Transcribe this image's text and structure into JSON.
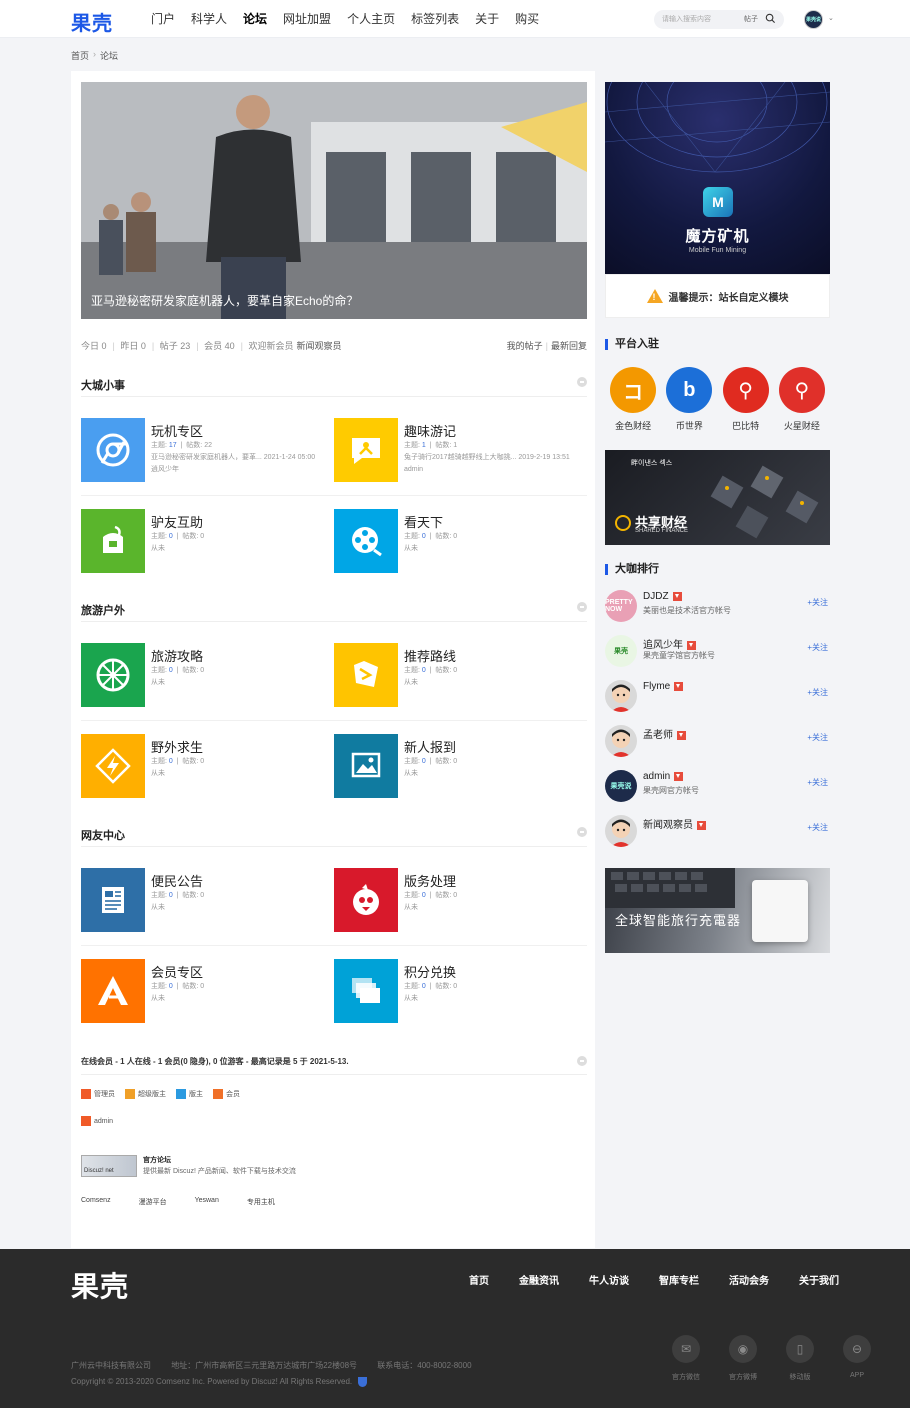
{
  "header": {
    "logo": "果壳",
    "nav": [
      "门户",
      "科学人",
      "论坛",
      "网址加盟",
      "个人主页",
      "标签列表",
      "关于",
      "购买"
    ],
    "active_nav": "论坛",
    "search_placeholder": "请输入搜索内容",
    "search_type": "帖子"
  },
  "breadcrumb": {
    "home": "首页",
    "sep": "›",
    "current": "论坛"
  },
  "banner": {
    "caption": "亚马逊秘密研发家庭机器人，要革自家Echo的命？"
  },
  "stats": {
    "today": "今日 0",
    "yesterday": "昨日 0",
    "posts": "帖子 23",
    "members": "会员 40",
    "welcome": "欢迎新会员 ",
    "new_member": "新闻观察员",
    "my_posts": "我的帖子",
    "latest_reply": "最新回复"
  },
  "sections": [
    {
      "title": "大城小事",
      "forums": [
        {
          "name": "玩机专区",
          "topics": "17",
          "posts": "22",
          "last": "亚马逊秘密研发家庭机器人，要革... 2021-1-24 05:00 逍风少年",
          "color": "#4a9ef0"
        },
        {
          "name": "趣味游记",
          "topics": "1",
          "posts": "1",
          "last": "兔子骑行2017越骑越野线上大咖挑... 2019-2-19 13:51 admin",
          "color": "#ffcb00"
        },
        {
          "name": "驴友互助",
          "topics": "0",
          "posts": "0",
          "last": "从未",
          "color": "#5ab52c"
        },
        {
          "name": "看天下",
          "topics": "0",
          "posts": "0",
          "last": "从未",
          "color": "#00a6e6"
        }
      ]
    },
    {
      "title": "旅游户外",
      "forums": [
        {
          "name": "旅游攻略",
          "topics": "0",
          "posts": "0",
          "last": "从未",
          "color": "#1aa54e"
        },
        {
          "name": "推荐路线",
          "topics": "0",
          "posts": "0",
          "last": "从未",
          "color": "#ffc400"
        },
        {
          "name": "野外求生",
          "topics": "0",
          "posts": "0",
          "last": "从未",
          "color": "#ffaf00"
        },
        {
          "name": "新人报到",
          "topics": "0",
          "posts": "0",
          "last": "从未",
          "color": "#107ba0"
        }
      ]
    },
    {
      "title": "网友中心",
      "forums": [
        {
          "name": "便民公告",
          "topics": "0",
          "posts": "0",
          "last": "从未",
          "color": "#2e6fa7"
        },
        {
          "name": "版务处理",
          "topics": "0",
          "posts": "0",
          "last": "从未",
          "color": "#d8192b"
        },
        {
          "name": "会员专区",
          "topics": "0",
          "posts": "0",
          "last": "从未",
          "color": "#ff7200"
        },
        {
          "name": "积分兑换",
          "topics": "0",
          "posts": "0",
          "last": "从未",
          "color": "#00a2d7"
        }
      ]
    }
  ],
  "forum_labels": {
    "topics": "主题: ",
    "posts": "帖数: "
  },
  "online": {
    "title": "在线会员 - 1 人在线 - 1 会员(0 隐身), 0 位游客 - 最高记录是 5 于 2021-5-13.",
    "legend": [
      {
        "label": "管理员",
        "color": "#f05a28"
      },
      {
        "label": "超级版主",
        "color": "#f0a028"
      },
      {
        "label": "版主",
        "color": "#2b9ae0"
      },
      {
        "label": "会员",
        "color": "#f07028"
      }
    ],
    "user": "admin"
  },
  "official": {
    "badge": "Discuz! net",
    "title": "官方论坛",
    "desc": "提供最新 Discuz! 产品新闻、软件下载与技术交流"
  },
  "links": [
    "Comsenz",
    "漫游平台",
    "Yeswan",
    "专用主机"
  ],
  "sidebar": {
    "ad_logo": "M",
    "ad_title": "魔方矿机",
    "ad_sub": "Mobile Fun Mining",
    "notice": "温馨提示：站长自定义模块",
    "platform_title": "平台入驻",
    "platforms": [
      {
        "name": "金色财经",
        "color": "#f39800",
        "glyph": "コ"
      },
      {
        "name": "币世界",
        "color": "#1c6fd8",
        "glyph": "b"
      },
      {
        "name": "巴比特",
        "color": "#e02b20",
        "glyph": "⚲"
      },
      {
        "name": "火星财经",
        "color": "#e0302a",
        "glyph": "⚲"
      }
    ],
    "ad2_top": "畔이낸스 섹스",
    "ad2_title": "共享财经",
    "ad2_sub": "SHARED FINANCE",
    "rank_title": "大咖排行",
    "follow_label": "+关注",
    "rank": [
      {
        "name": "DJDZ",
        "desc": "美丽也是技术活官方帐号",
        "bg": "#e9a0b5",
        "av": "PRETTY NOW"
      },
      {
        "name": "追风少年",
        "desc": "果壳童学馆官方帐号",
        "bg": "#e9f6e4",
        "av": "果壳"
      },
      {
        "name": "Flyme",
        "desc": "",
        "bg": "#d9d9d9",
        "av": ""
      },
      {
        "name": "孟老师",
        "desc": "",
        "bg": "#d9d9d9",
        "av": ""
      },
      {
        "name": "admin",
        "desc": "果壳网官方帐号",
        "bg": "#1d2b4a",
        "av": "果壳说"
      },
      {
        "name": "新闻观察员",
        "desc": "",
        "bg": "#d9d9d9",
        "av": ""
      }
    ],
    "ad3_text": "全球智能旅行充電器"
  },
  "footer": {
    "logo": "果壳",
    "nav": [
      "首页",
      "金融资讯",
      "牛人访谈",
      "智库专栏",
      "活动会务",
      "关于我们"
    ],
    "company": "广州云中科技有限公司",
    "address": "地址：广州市高新区三元里路万达城市广场22楼08号",
    "phone": "联系电话：400-8002-8000",
    "copyright": "Copyright © 2013-2020  Comsenz Inc. Powered by Discuz! All Rights Reserved.",
    "icons": [
      {
        "label": "官方微信",
        "glyph": "✉"
      },
      {
        "label": "官方微博",
        "glyph": "◉"
      },
      {
        "label": "移动版",
        "glyph": "▯"
      },
      {
        "label": "APP",
        "glyph": "⊖"
      }
    ]
  }
}
